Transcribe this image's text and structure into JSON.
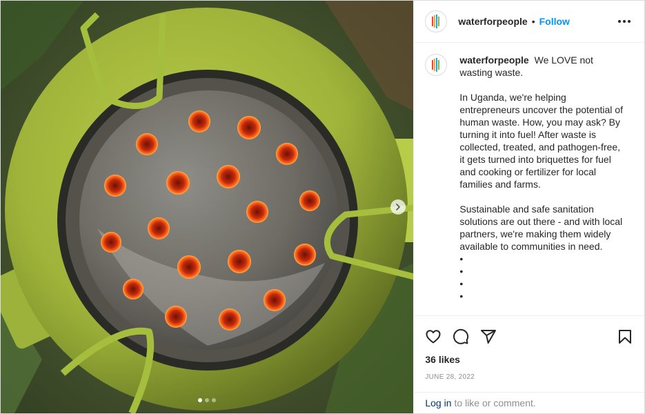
{
  "post": {
    "username": "waterforpeople",
    "separator": "•",
    "follow_label": "Follow",
    "caption_intro": "We LOVE not wasting waste.",
    "caption_paragraphs": [
      "In Uganda, we're helping entrepreneurs uncover the potential of human waste. How, you may ask? By turning it into fuel! After waste is collected, treated, and pathogen-free, it gets turned into briquettes for fuel and cooking or fertilizer for local families and farms.",
      "Sustainable and safe sanitation solutions are out there - and with local partners, we're making them widely available to communities in need."
    ],
    "caption_bullets": [
      "•",
      "•",
      "•",
      "•"
    ],
    "likes": "36 likes",
    "date": "JUNE 28, 2022",
    "login_link": "Log in",
    "login_text": "to like or comment."
  },
  "carousel": {
    "current": 1,
    "total": 3
  },
  "icons": {
    "more": "more-options-icon",
    "like": "heart-icon",
    "comment": "comment-icon",
    "share": "paper-plane-icon",
    "save": "bookmark-icon",
    "next": "chevron-right-icon"
  },
  "colors": {
    "accent": "#0095f6",
    "link": "#00376b",
    "muted": "#8e8e8e"
  }
}
